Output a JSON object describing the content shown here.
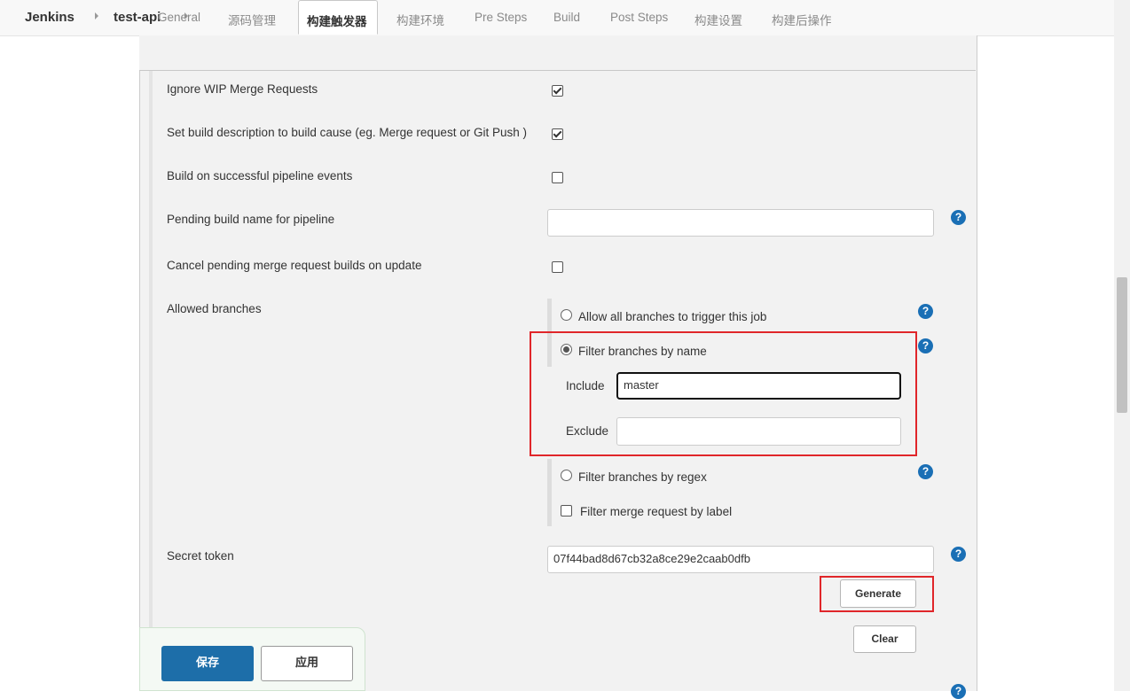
{
  "breadcrumb": {
    "root": "Jenkins",
    "job": "test-api"
  },
  "tabs": [
    {
      "label": "General"
    },
    {
      "label": "源码管理"
    },
    {
      "label": "构建触发器"
    },
    {
      "label": "构建环境"
    },
    {
      "label": "Pre Steps"
    },
    {
      "label": "Build"
    },
    {
      "label": "Post Steps"
    },
    {
      "label": "构建设置"
    },
    {
      "label": "构建后操作"
    }
  ],
  "active_tab": "构建触发器",
  "options": {
    "ignore_wip": {
      "label": "Ignore WIP Merge Requests",
      "checked": true
    },
    "set_build_desc": {
      "label": "Set build description to build cause (eg. Merge request or Git Push )",
      "checked": true
    },
    "build_on_pipeline": {
      "label": "Build on successful pipeline events",
      "checked": false
    },
    "pending_build_name": {
      "label": "Pending build name for pipeline",
      "value": ""
    },
    "cancel_pending": {
      "label": "Cancel pending merge request builds on update",
      "checked": false
    }
  },
  "allowed_branches": {
    "label": "Allowed branches",
    "allow_all": "Allow all branches to trigger this job",
    "filter_by_name": "Filter branches by name",
    "include_label": "Include",
    "include_value": "master",
    "exclude_label": "Exclude",
    "exclude_value": "",
    "filter_by_regex": "Filter branches by regex",
    "filter_by_label": "Filter merge request by label",
    "selected": "Filter branches by name"
  },
  "secret_token": {
    "label": "Secret token",
    "value": "07f44bad8d67cb32a8ce29e2caab0dfb",
    "generate_label": "Generate",
    "clear_label": "Clear"
  },
  "footer": {
    "save_label": "保存",
    "apply_label": "应用"
  },
  "colors": {
    "primary_button": "#1d6ea9",
    "help_icon": "#1a6fb5",
    "highlight": "#e0262a",
    "panel_bg": "#f2f2f2"
  }
}
